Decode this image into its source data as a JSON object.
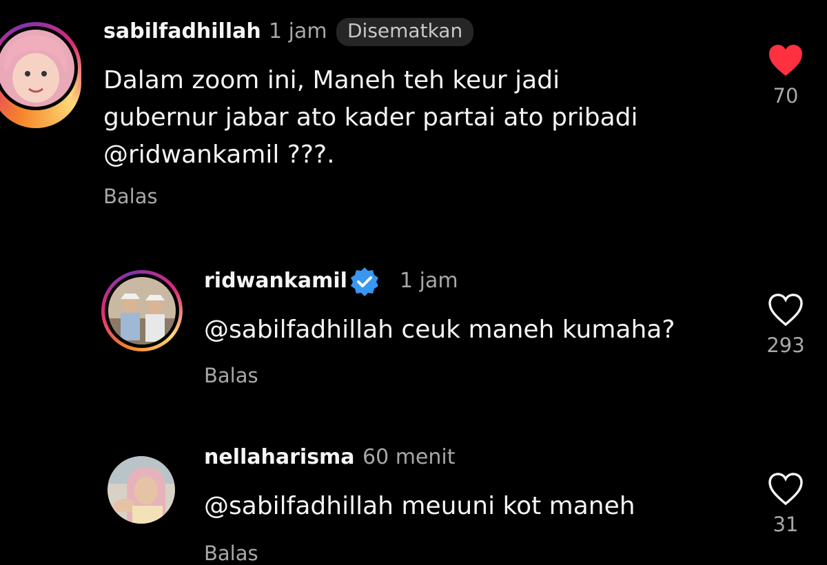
{
  "comments": [
    {
      "username": "sabilfadhillah",
      "time": "1 jam",
      "badge": "Disematkan",
      "lines": [
        "Dalam zoom ini, Maneh teh keur jadi",
        "gubernur jabar ato kader partai ato pribadi",
        "@ridwankamil ???."
      ],
      "reply_label": "Balas",
      "likes": "70",
      "liked": true,
      "like_color": "#ff3040"
    },
    {
      "username": "ridwankamil",
      "verified": true,
      "time": "1 jam",
      "lines": [
        "@sabilfadhillah ceuk maneh kumaha?"
      ],
      "reply_label": "Balas",
      "likes": "293",
      "liked": false
    },
    {
      "username": "nellaharisma",
      "time": "60 menit",
      "lines": [
        "@sabilfadhillah meuuni kot maneh"
      ],
      "reply_label": "Balas",
      "likes": "31",
      "liked": false
    }
  ],
  "icons": {
    "like": "heart-icon",
    "verified": "verified-badge-icon"
  },
  "colors": {
    "background": "#000000",
    "verified": "#3897f0",
    "secondary_text": "#a8a8a8"
  }
}
